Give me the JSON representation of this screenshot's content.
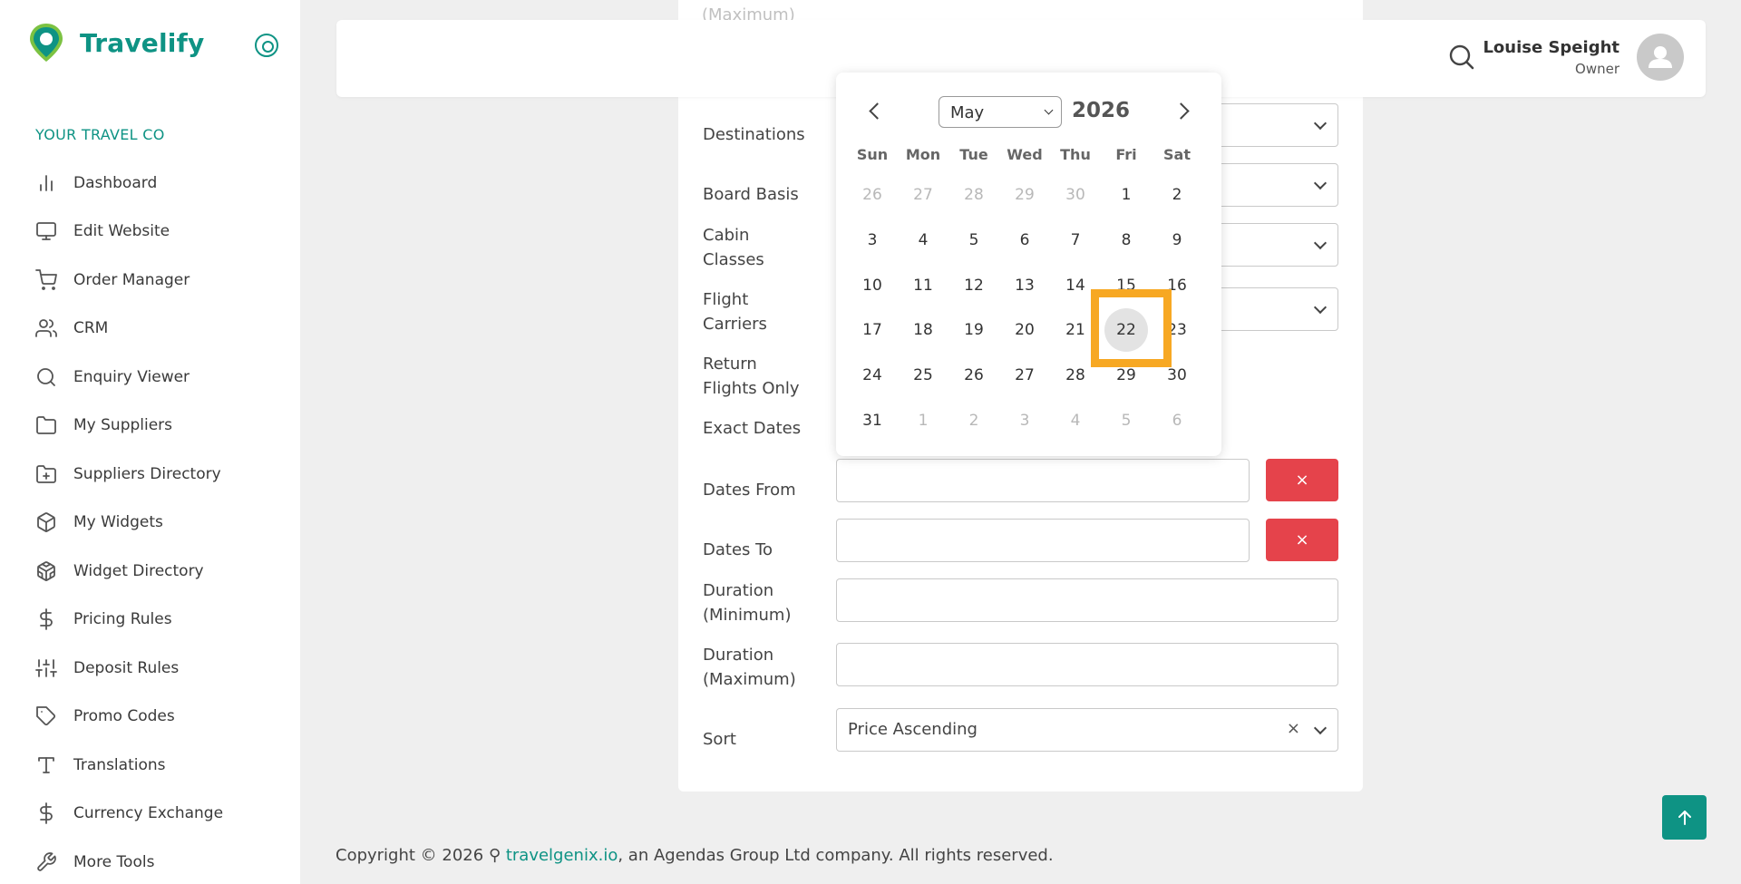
{
  "app": {
    "brand_name": "Travelify",
    "org_label": "YOUR TRAVEL CO",
    "accent_color": "#0e9384"
  },
  "sidebar": {
    "items": [
      {
        "label": "Dashboard",
        "icon": "bar-chart-icon"
      },
      {
        "label": "Edit Website",
        "icon": "monitor-icon"
      },
      {
        "label": "Order Manager",
        "icon": "shopping-cart-icon"
      },
      {
        "label": "CRM",
        "icon": "users-icon"
      },
      {
        "label": "Enquiry Viewer",
        "icon": "search-icon"
      },
      {
        "label": "My Suppliers",
        "icon": "folder-icon"
      },
      {
        "label": "Suppliers Directory",
        "icon": "folder-plus-icon"
      },
      {
        "label": "My Widgets",
        "icon": "box-icon"
      },
      {
        "label": "Widget Directory",
        "icon": "codesandbox-icon"
      },
      {
        "label": "Pricing Rules",
        "icon": "dollar-icon"
      },
      {
        "label": "Deposit Rules",
        "icon": "sliders-icon"
      },
      {
        "label": "Promo Codes",
        "icon": "tag-icon"
      },
      {
        "label": "Translations",
        "icon": "type-icon"
      },
      {
        "label": "Currency Exchange",
        "icon": "dollar-icon"
      },
      {
        "label": "More Tools",
        "icon": "tool-icon"
      }
    ]
  },
  "header": {
    "user_name": "Louise Speight",
    "user_role": "Owner"
  },
  "form": {
    "ghost_label": "(Maximum)",
    "labels": {
      "destinations": "Destinations",
      "board_basis": "Board Basis",
      "cabin_classes": "Cabin\nClasses",
      "flight_carriers": "Flight\nCarriers",
      "return_flights": "Return\nFlights Only",
      "exact_dates": "Exact Dates",
      "dates_from": "Dates From",
      "dates_to": "Dates To",
      "duration_min": "Duration\n(Minimum)",
      "duration_max": "Duration\n(Maximum)",
      "sort": "Sort"
    },
    "dates_from_value": "",
    "dates_to_value": "",
    "duration_min_value": "",
    "duration_max_value": "",
    "clear_label": "×",
    "sort_value": "Price Ascending",
    "sort_clear": "×"
  },
  "calendar": {
    "month": "May",
    "year": "2026",
    "weekdays": [
      "Sun",
      "Mon",
      "Tue",
      "Wed",
      "Thu",
      "Fri",
      "Sat"
    ],
    "weeks": [
      [
        {
          "d": "26",
          "m": true
        },
        {
          "d": "27",
          "m": true
        },
        {
          "d": "28",
          "m": true
        },
        {
          "d": "29",
          "m": true
        },
        {
          "d": "30",
          "m": true
        },
        {
          "d": "1"
        },
        {
          "d": "2"
        }
      ],
      [
        {
          "d": "3"
        },
        {
          "d": "4"
        },
        {
          "d": "5"
        },
        {
          "d": "6"
        },
        {
          "d": "7"
        },
        {
          "d": "8"
        },
        {
          "d": "9"
        }
      ],
      [
        {
          "d": "10"
        },
        {
          "d": "11"
        },
        {
          "d": "12"
        },
        {
          "d": "13"
        },
        {
          "d": "14"
        },
        {
          "d": "15"
        },
        {
          "d": "16"
        }
      ],
      [
        {
          "d": "17"
        },
        {
          "d": "18"
        },
        {
          "d": "19"
        },
        {
          "d": "20"
        },
        {
          "d": "21"
        },
        {
          "d": "22",
          "s": true
        },
        {
          "d": "23"
        }
      ],
      [
        {
          "d": "24"
        },
        {
          "d": "25"
        },
        {
          "d": "26"
        },
        {
          "d": "27"
        },
        {
          "d": "28"
        },
        {
          "d": "29"
        },
        {
          "d": "30"
        }
      ],
      [
        {
          "d": "31"
        },
        {
          "d": "1",
          "m": true
        },
        {
          "d": "2",
          "m": true
        },
        {
          "d": "3",
          "m": true
        },
        {
          "d": "4",
          "m": true
        },
        {
          "d": "5",
          "m": true
        },
        {
          "d": "6",
          "m": true
        }
      ]
    ],
    "selected_day": "22",
    "highlight_color": "#f7a823"
  },
  "footer": {
    "prefix": "Copyright © 2026 ",
    "link_text": "travelgenix.io",
    "suffix": ", an Agendas Group Ltd company. All rights reserved."
  }
}
